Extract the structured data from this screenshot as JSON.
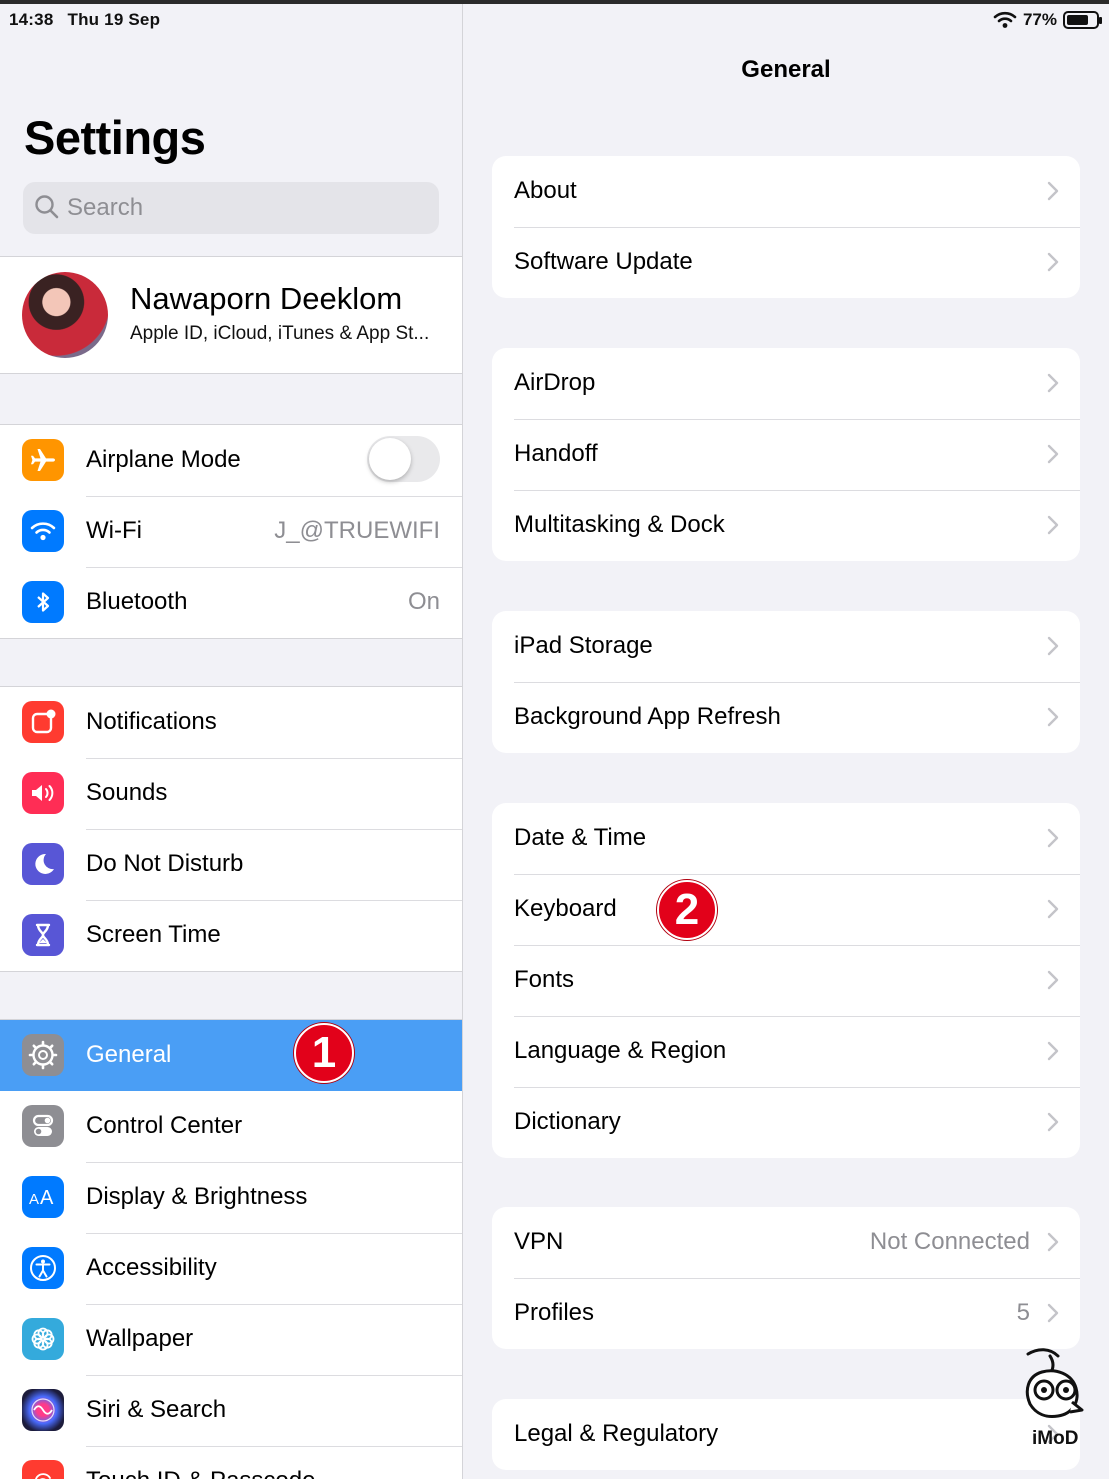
{
  "status_bar": {
    "time": "14:38",
    "date": "Thu 19 Sep",
    "battery": "77%"
  },
  "sidebar": {
    "title": "Settings",
    "search": {
      "placeholder": "Search"
    },
    "profile": {
      "name": "Nawaporn Deeklom",
      "subtitle": "Apple ID, iCloud, iTunes & App St..."
    },
    "groups": [
      [
        {
          "label": "Airplane Mode",
          "icon": "airplane-icon",
          "color": "#ff9500",
          "toggle": false
        },
        {
          "label": "Wi-Fi",
          "icon": "wifi-icon",
          "color": "#007aff",
          "value": "J_@TRUEWIFI"
        },
        {
          "label": "Bluetooth",
          "icon": "bluetooth-icon",
          "color": "#007aff",
          "value": "On"
        }
      ],
      [
        {
          "label": "Notifications",
          "icon": "notifications-icon",
          "color": "#ff3b30"
        },
        {
          "label": "Sounds",
          "icon": "sounds-icon",
          "color": "#ff2d55"
        },
        {
          "label": "Do Not Disturb",
          "icon": "moon-icon",
          "color": "#5856d6"
        },
        {
          "label": "Screen Time",
          "icon": "hourglass-icon",
          "color": "#5856d6"
        }
      ],
      [
        {
          "label": "General",
          "icon": "gear-icon",
          "color": "#8e8e93",
          "selected": true
        },
        {
          "label": "Control Center",
          "icon": "control-center-icon",
          "color": "#8e8e93"
        },
        {
          "label": "Display & Brightness",
          "icon": "display-icon",
          "color": "#007aff"
        },
        {
          "label": "Accessibility",
          "icon": "accessibility-icon",
          "color": "#007aff"
        },
        {
          "label": "Wallpaper",
          "icon": "wallpaper-icon",
          "color": "#34aadc"
        },
        {
          "label": "Siri & Search",
          "icon": "siri-icon",
          "color": "#1c1c3c"
        },
        {
          "label": "Touch ID & Passcode",
          "icon": "fingerprint-icon",
          "color": "#ff3b30"
        }
      ]
    ],
    "badge": "1"
  },
  "detail": {
    "title": "General",
    "cards": [
      [
        {
          "label": "About"
        },
        {
          "label": "Software Update"
        }
      ],
      [
        {
          "label": "AirDrop"
        },
        {
          "label": "Handoff"
        },
        {
          "label": "Multitasking & Dock"
        }
      ],
      [
        {
          "label": "iPad Storage"
        },
        {
          "label": "Background App Refresh"
        }
      ],
      [
        {
          "label": "Date & Time"
        },
        {
          "label": "Keyboard"
        },
        {
          "label": "Fonts"
        },
        {
          "label": "Language & Region"
        },
        {
          "label": "Dictionary"
        }
      ],
      [
        {
          "label": "VPN",
          "value": "Not Connected"
        },
        {
          "label": "Profiles",
          "value": "5"
        }
      ],
      [
        {
          "label": "Legal & Regulatory"
        }
      ]
    ],
    "badge": "2"
  },
  "watermark": {
    "text": "iMoD"
  },
  "colors": {
    "selection": "#4a9ef5",
    "badge": "#e2011a",
    "background": "#f2f2f7"
  }
}
